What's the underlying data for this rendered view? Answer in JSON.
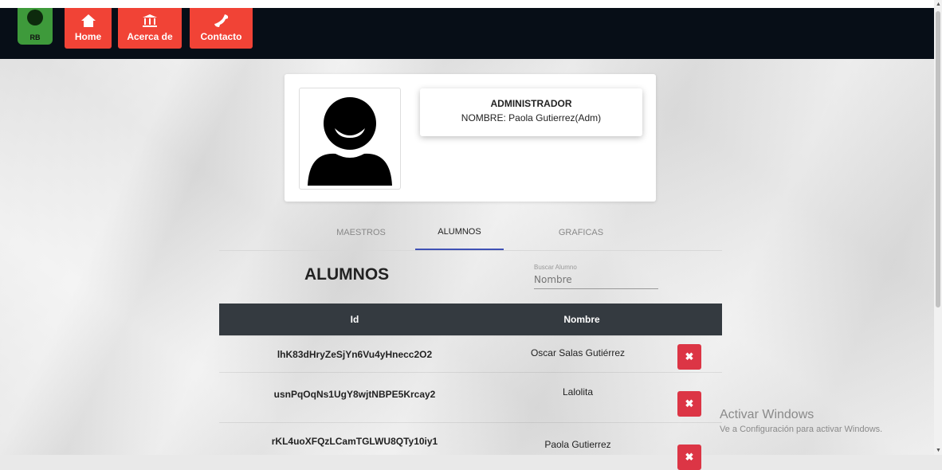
{
  "nav": {
    "logo_text": "RB",
    "items": [
      {
        "label": "Home",
        "icon": "home-icon"
      },
      {
        "label": "Acerca de",
        "icon": "bank-icon"
      },
      {
        "label": "Contacto",
        "icon": "phone-icon"
      }
    ]
  },
  "profile": {
    "role": "ADMINISTRADOR",
    "name": "NOMBRE: Paola Gutierrez(Adm)",
    "avatar_icon": "user-avatar-icon"
  },
  "tabs": [
    {
      "label": "MAESTROS",
      "active": false
    },
    {
      "label": "ALUMNOS",
      "active": true
    },
    {
      "label": "GRAFICAS",
      "active": false
    }
  ],
  "section": {
    "title": "ALUMNOS",
    "search_label": "Buscar Alumno",
    "search_placeholder": "Nombre"
  },
  "table": {
    "headers": [
      "Id",
      "Nombre"
    ],
    "rows": [
      {
        "id": "lhK83dHryZeSjYn6Vu4yHnecc2O2",
        "nombre": "Oscar Salas Gutiérrez"
      },
      {
        "id": "usnPqOqNs1UgY8wjtNBPE5Krcay2",
        "nombre": "Lalolita"
      },
      {
        "id": "rKL4uoXFQzLCamTGLWU8QTy10iy1",
        "nombre": "Paola Gutierrez"
      }
    ],
    "delete_label": "✖"
  },
  "watermark": {
    "line1": "Activar Windows",
    "line2": "Ve a Configuración para activar Windows."
  },
  "colors": {
    "navbar": "#070e17",
    "nav_button": "#f14336",
    "logo": "#3e9a3b",
    "table_header": "#343a40",
    "delete_button": "#dc3545",
    "tab_indicator": "#3f51b5"
  }
}
